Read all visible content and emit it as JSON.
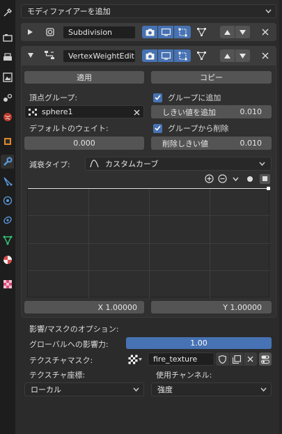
{
  "add_modifier": {
    "label": "モディファイアーを追加"
  },
  "modifiers": [
    {
      "name": "Subdivision",
      "collapsed": true
    },
    {
      "name": "VertexWeightEdit",
      "collapsed": false
    }
  ],
  "actions": {
    "apply": "適用",
    "copy": "コピー"
  },
  "vertex_group": {
    "label": "頂点グループ:",
    "value": "sphere1"
  },
  "add_to_group": {
    "label": "グループに追加",
    "checked": true
  },
  "add_threshold": {
    "label": "しきい値を追加",
    "value": "0.010"
  },
  "default_weight": {
    "label": "デフォルトのウェイト:",
    "value": "0.000"
  },
  "remove_from_group": {
    "label": "グループから削除",
    "checked": true
  },
  "remove_threshold": {
    "label": "削除しきい値",
    "value": "0.010"
  },
  "falloff": {
    "label": "減衰タイプ:",
    "value": "カスタムカーブ"
  },
  "curve": {
    "x_label": "X 1.00000",
    "y_label": "Y 1.00000"
  },
  "influence": {
    "section_label": "影響/マスクのオプション:",
    "global_label": "グローバルへの影響力:",
    "global_value": "1.00",
    "global_fraction": 1.0,
    "texture_mask_label": "テクスチャマスク:",
    "texture_name": "fire_texture",
    "tex_coords_label": "テクスチャ座標:",
    "tex_coords_value": "ローカル",
    "channel_label": "使用チャンネル:",
    "channel_value": "強度"
  },
  "colors": {
    "accent": "#4772b3",
    "panel": "#2b2b2b",
    "tabbar": "#1d1d1d"
  }
}
